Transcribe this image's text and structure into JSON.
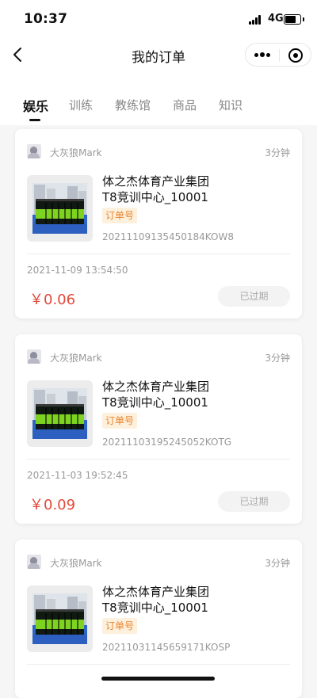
{
  "status_bar": {
    "time": "10:37",
    "network": "4G"
  },
  "nav": {
    "title": "我的订单"
  },
  "tabs": [
    {
      "label": "娱乐",
      "active": true
    },
    {
      "label": "训练",
      "active": false
    },
    {
      "label": "教练馆",
      "active": false
    },
    {
      "label": "商品",
      "active": false
    },
    {
      "label": "知识",
      "active": false
    }
  ],
  "orders": [
    {
      "user": "大灰狼Mark",
      "time_ago": "3分钟",
      "venue_line1": "体之杰体育产业集团",
      "venue_line2": "T8竞训中心_10001",
      "tag": "订单号",
      "order_no": "20211109135450184KOW8",
      "date": "2021-11-09 13:54:50",
      "price": "￥0.06",
      "status": "已过期"
    },
    {
      "user": "大灰狼Mark",
      "time_ago": "3分钟",
      "venue_line1": "体之杰体育产业集团",
      "venue_line2": "T8竞训中心_10001",
      "tag": "订单号",
      "order_no": "20211103195245052KOTG",
      "date": "2021-11-03 19:52:45",
      "price": "￥0.09",
      "status": "已过期"
    },
    {
      "user": "大灰狼Mark",
      "time_ago": "3分钟",
      "venue_line1": "体之杰体育产业集团",
      "venue_line2": "T8竞训中心_10001",
      "tag": "订单号",
      "order_no": "20211031145659171KOSP"
    }
  ]
}
